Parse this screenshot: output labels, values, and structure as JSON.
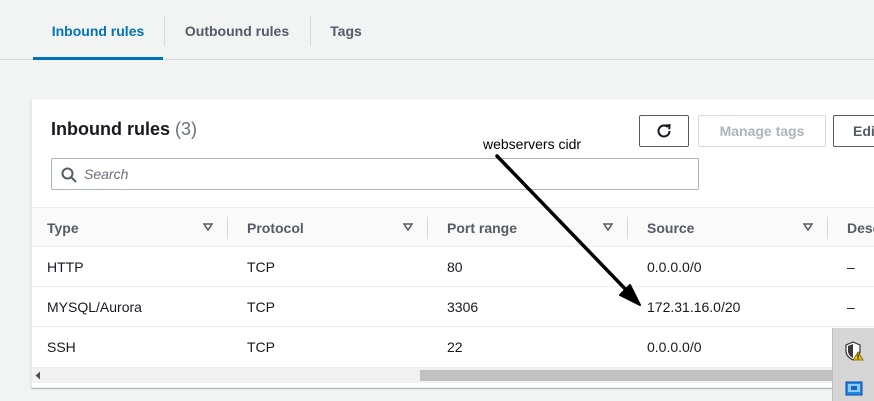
{
  "tabs": [
    {
      "label": "Inbound rules",
      "active": true
    },
    {
      "label": "Outbound rules",
      "active": false
    },
    {
      "label": "Tags",
      "active": false
    }
  ],
  "panel": {
    "title": "Inbound rules",
    "count": "(3)",
    "buttons": {
      "manage_tags": "Manage tags",
      "edit": "Edi"
    },
    "search": {
      "placeholder": "Search",
      "value": ""
    }
  },
  "table": {
    "columns": [
      "Type",
      "Protocol",
      "Port range",
      "Source",
      "Desc"
    ],
    "rows": [
      {
        "type": "HTTP",
        "protocol": "TCP",
        "port": "80",
        "source": "0.0.0.0/0",
        "desc": "–"
      },
      {
        "type": "MYSQL/Aurora",
        "protocol": "TCP",
        "port": "3306",
        "source": "172.31.16.0/20",
        "desc": "–"
      },
      {
        "type": "SSH",
        "protocol": "TCP",
        "port": "22",
        "source": "0.0.0.0/0",
        "desc": ""
      }
    ]
  },
  "annotation": {
    "text": "webservers cidr"
  },
  "colors": {
    "accent": "#0073bb",
    "text": "#16191f",
    "muted": "#545b64"
  },
  "icons": [
    "refresh-icon",
    "search-icon",
    "sort-icon",
    "shield-warning-icon",
    "network-icon"
  ]
}
